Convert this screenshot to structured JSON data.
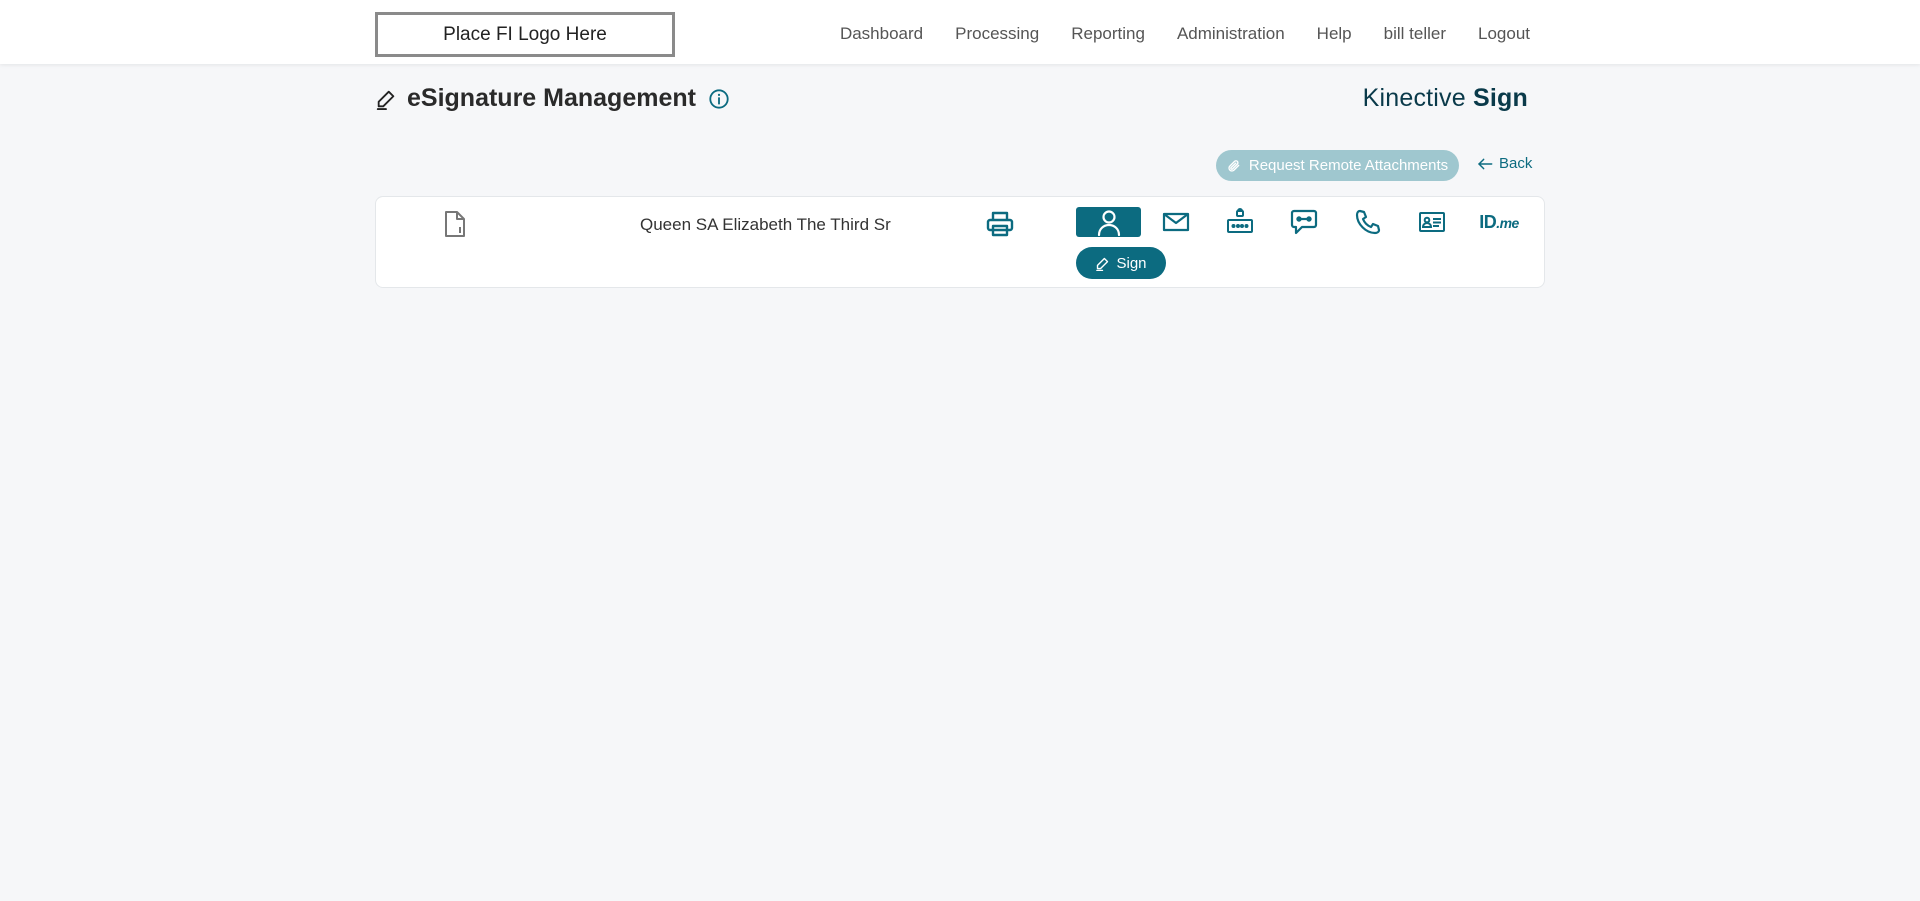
{
  "header": {
    "logo_text": "Place FI Logo Here",
    "nav": [
      "Dashboard",
      "Processing",
      "Reporting",
      "Administration",
      "Help",
      "bill teller",
      "Logout"
    ]
  },
  "page": {
    "title": "eSignature Management",
    "brand_light": "Kinective",
    "brand_bold": "Sign"
  },
  "actions": {
    "request_attachments": "Request Remote Attachments",
    "back": "Back"
  },
  "signer": {
    "name": "Queen SA Elizabeth The Third Sr",
    "sign_label": "Sign",
    "idme_label_a": "ID",
    "idme_label_b": ".me"
  },
  "colors": {
    "accent": "#0c6b80",
    "accent_disabled": "#9fc7cf",
    "background": "#f6f7f9"
  }
}
